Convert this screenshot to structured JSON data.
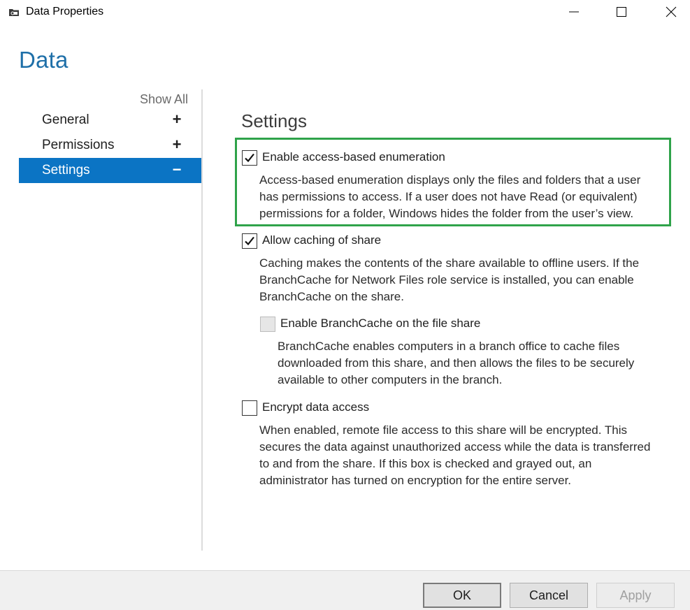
{
  "window": {
    "title": "Data Properties",
    "icon": "share-folder-icon"
  },
  "page": {
    "title": "Data"
  },
  "nav": {
    "show_all": "Show All",
    "items": [
      {
        "label": "General",
        "toggle": "+",
        "active": false
      },
      {
        "label": "Permissions",
        "toggle": "+",
        "active": false
      },
      {
        "label": "Settings",
        "toggle": "−",
        "active": true
      }
    ]
  },
  "settings": {
    "title": "Settings",
    "abe": {
      "label": "Enable access-based enumeration",
      "checked": true,
      "desc": [
        "Access-based enumeration displays only the files and folders that a user",
        "has permissions to access. If a user does not have Read (or equivalent)",
        "permissions for a folder, Windows hides the folder from the user’s view."
      ]
    },
    "caching": {
      "label": "Allow caching of share",
      "checked": true,
      "desc": [
        "Caching makes the contents of the share available to offline users. If the",
        "BranchCache for Network Files role service is installed, you can enable",
        "BranchCache on the share."
      ]
    },
    "branchcache": {
      "label": "Enable BranchCache on the file share",
      "checked": false,
      "enabled": false,
      "desc": [
        "BranchCache enables computers in a branch office to cache files",
        "downloaded from this share, and then allows the files to be securely",
        "available to other computers in the branch."
      ]
    },
    "encrypt": {
      "label": "Encrypt data access",
      "checked": false,
      "desc": [
        "When enabled, remote file access to this share will be encrypted. This",
        "secures the data against unauthorized access while the data is transferred",
        "to and from the share. If this box is checked and grayed out, an",
        "administrator has turned on encryption for the entire server."
      ]
    }
  },
  "buttons": {
    "ok": "OK",
    "cancel": "Cancel",
    "apply": "Apply"
  },
  "colors": {
    "accent": "#0b74c4",
    "title_blue": "#1e6fa8",
    "highlight_green": "#2fa34a"
  }
}
